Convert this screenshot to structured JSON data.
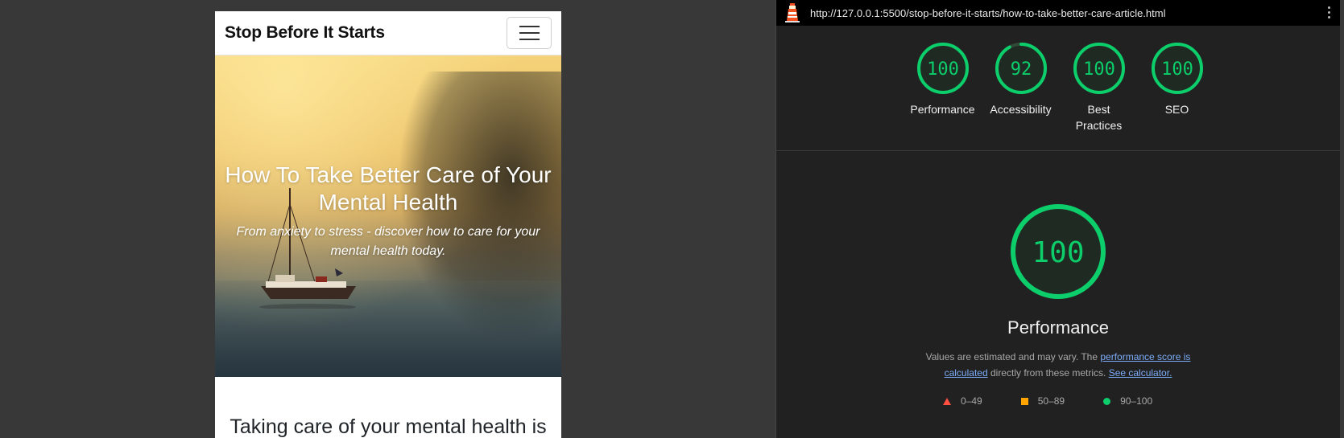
{
  "preview": {
    "brand": "Stop Before It Starts",
    "hero": {
      "title": "How To Take Better Care of Your Mental Health",
      "subtitle": "From anxiety to stress - discover how to care for your mental health today."
    },
    "article_heading": "Taking care of your mental health is"
  },
  "lighthouse": {
    "url": "http://127.0.0.1:5500/stop-before-it-starts/how-to-take-better-care-article.html",
    "scores": [
      {
        "label": "Performance",
        "value": "100",
        "fraction": 1.0
      },
      {
        "label": "Accessibility",
        "value": "92",
        "fraction": 0.92
      },
      {
        "label": "Best Practices",
        "value": "100",
        "fraction": 1.0
      },
      {
        "label": "SEO",
        "value": "100",
        "fraction": 1.0
      }
    ],
    "main": {
      "title": "Performance",
      "value": "100",
      "desc_prefix": "Values are estimated and may vary. The ",
      "desc_link1": "performance score is calculated",
      "desc_middle": " directly from these metrics. ",
      "desc_link2": "See calculator."
    },
    "legend": [
      {
        "shape": "triangle",
        "color": "#ff4e42",
        "label": "0–49"
      },
      {
        "shape": "square",
        "color": "#ffa400",
        "label": "50–89"
      },
      {
        "shape": "circle",
        "color": "#0cce6b",
        "label": "90–100"
      }
    ],
    "colors": {
      "pass": "#0cce6b",
      "pass_text": "#0cce6b"
    }
  }
}
